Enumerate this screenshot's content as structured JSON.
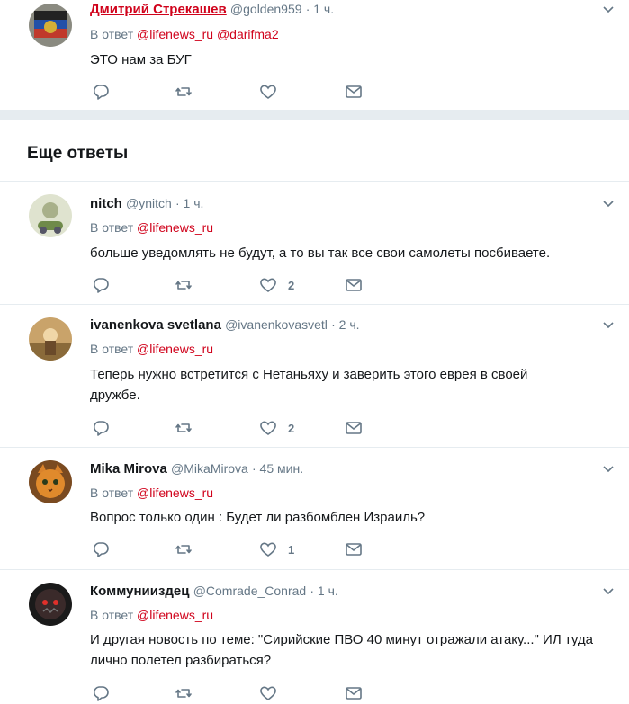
{
  "tweets": [
    {
      "name": "Дмитрий Стрекашев",
      "handle": "@golden959",
      "time": "· 1 ч.",
      "reply_prefix": "В ответ",
      "mentions": [
        "@lifenews_ru",
        "@darifma2"
      ],
      "text": "ЭТО нам за БУГ",
      "likes": ""
    },
    {
      "name": "nitch",
      "handle": "@ynitch",
      "time": "· 1 ч.",
      "reply_prefix": "В ответ",
      "mentions": [
        "@lifenews_ru"
      ],
      "text": "больше уведомлять не будут, а то вы так все свои самолеты посбиваете.",
      "likes": "2"
    },
    {
      "name": "ivanenkova svetlana",
      "handle": "@ivanenkovasvetl",
      "time": "· 2 ч.",
      "reply_prefix": "В ответ",
      "mentions": [
        "@lifenews_ru"
      ],
      "text": "Теперь нужно встретится  с Нетаньяху и заверить этого  еврея в своей дружбе.",
      "likes": "2"
    },
    {
      "name": "Mika Mirova",
      "handle": "@MikaMirova",
      "time": "· 45 мин.",
      "reply_prefix": "В ответ",
      "mentions": [
        "@lifenews_ru"
      ],
      "text": "Вопрос только один : Будет ли разбомблен Израиль?",
      "likes": "1"
    },
    {
      "name": "Коммунииздец",
      "handle": "@Comrade_Conrad",
      "time": "· 1 ч.",
      "reply_prefix": "В ответ",
      "mentions": [
        "@lifenews_ru"
      ],
      "text": "И другая новость по теме: \"Сирийские ПВО 40 минут отражали атаку...\" ИЛ туда лично полетел разбираться?",
      "likes": ""
    }
  ],
  "section": {
    "title": "Еще ответы"
  },
  "colors": {
    "mention": "#d0021b",
    "meta": "#657786",
    "divider": "#e6ecf0"
  }
}
